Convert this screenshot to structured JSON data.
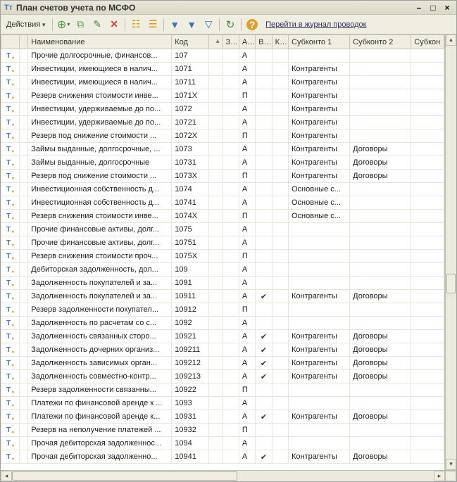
{
  "window": {
    "title": "План счетов учета по МСФО"
  },
  "toolbar": {
    "actions_label": "Действия",
    "journal_link": "Перейти в журнал проводок"
  },
  "columns": {
    "name": "Наименование",
    "code": "Код",
    "z": "З...",
    "a": "А...",
    "v": "В...",
    "k": "К...",
    "sk1": "Субконто 1",
    "sk2": "Субконто 2",
    "sk3": "Субкон"
  },
  "rows": [
    {
      "name": "Прочие долгосрочные, финансов...",
      "code": "107",
      "a": "А",
      "v": false,
      "sk1": "",
      "sk2": ""
    },
    {
      "name": "Инвестиции, имеющиеся в налич...",
      "code": "1071",
      "a": "А",
      "v": false,
      "sk1": "Контрагенты",
      "sk2": ""
    },
    {
      "name": "Инвестиции, имеющиеся в налич...",
      "code": "10711",
      "a": "А",
      "v": false,
      "sk1": "Контрагенты",
      "sk2": ""
    },
    {
      "name": "Резерв снижения стоимости инве...",
      "code": "1071Х",
      "a": "П",
      "v": false,
      "sk1": "Контрагенты",
      "sk2": ""
    },
    {
      "name": "Инвестиции, удерживаемые до по...",
      "code": "1072",
      "a": "А",
      "v": false,
      "sk1": "Контрагенты",
      "sk2": ""
    },
    {
      "name": "Инвестиции, удерживаемые до по...",
      "code": "10721",
      "a": "А",
      "v": false,
      "sk1": "Контрагенты",
      "sk2": ""
    },
    {
      "name": "Резерв под снижение стоимости ...",
      "code": "1072Х",
      "a": "П",
      "v": false,
      "sk1": "Контрагенты",
      "sk2": ""
    },
    {
      "name": "Займы выданные, долгосрочные, ...",
      "code": "1073",
      "a": "А",
      "v": false,
      "sk1": "Контрагенты",
      "sk2": "Договоры"
    },
    {
      "name": "Займы выданные, долгосрочные",
      "code": "10731",
      "a": "А",
      "v": false,
      "sk1": "Контрагенты",
      "sk2": "Договоры"
    },
    {
      "name": "Резерв под снижение стоимости ...",
      "code": "1073Х",
      "a": "П",
      "v": false,
      "sk1": "Контрагенты",
      "sk2": "Договоры"
    },
    {
      "name": "Инвестиционная собственность д...",
      "code": "1074",
      "a": "А",
      "v": false,
      "sk1": "Основные с...",
      "sk2": ""
    },
    {
      "name": "Инвестиционная собственность д...",
      "code": "10741",
      "a": "А",
      "v": false,
      "sk1": "Основные с...",
      "sk2": ""
    },
    {
      "name": "Резерв снижения стоимости инве...",
      "code": "1074Х",
      "a": "П",
      "v": false,
      "sk1": "Основные с...",
      "sk2": ""
    },
    {
      "name": "Прочие финансовые активы, долг...",
      "code": "1075",
      "a": "А",
      "v": false,
      "sk1": "",
      "sk2": ""
    },
    {
      "name": "Прочие финансовые активы, долг...",
      "code": "10751",
      "a": "А",
      "v": false,
      "sk1": "",
      "sk2": ""
    },
    {
      "name": "Резерв снижения стоимости проч...",
      "code": "1075Х",
      "a": "П",
      "v": false,
      "sk1": "",
      "sk2": ""
    },
    {
      "name": "Дебиторская задолженность, дол...",
      "code": "109",
      "a": "А",
      "v": false,
      "sk1": "",
      "sk2": ""
    },
    {
      "name": "Задолженность покупателей и за...",
      "code": "1091",
      "a": "А",
      "v": false,
      "sk1": "",
      "sk2": ""
    },
    {
      "name": "Задолженность покупателей и за...",
      "code": "10911",
      "a": "А",
      "v": true,
      "sk1": "Контрагенты",
      "sk2": "Договоры"
    },
    {
      "name": "Резерв задолженности покупател...",
      "code": "10912",
      "a": "П",
      "v": false,
      "sk1": "",
      "sk2": ""
    },
    {
      "name": "Задолженность по расчетам со с...",
      "code": "1092",
      "a": "А",
      "v": false,
      "sk1": "",
      "sk2": ""
    },
    {
      "name": "Задолженность связанных сторо...",
      "code": "10921",
      "a": "А",
      "v": true,
      "sk1": "Контрагенты",
      "sk2": "Договоры"
    },
    {
      "name": "Задолженность дочерних организ...",
      "code": "109211",
      "a": "А",
      "v": true,
      "sk1": "Контрагенты",
      "sk2": "Договоры"
    },
    {
      "name": "Задолженность зависимых орган...",
      "code": "109212",
      "a": "А",
      "v": true,
      "sk1": "Контрагенты",
      "sk2": "Договоры"
    },
    {
      "name": "Задолженность совместно-контр...",
      "code": "109213",
      "a": "А",
      "v": true,
      "sk1": "Контрагенты",
      "sk2": "Договоры"
    },
    {
      "name": "Резерв задолженности связанны...",
      "code": "10922",
      "a": "П",
      "v": false,
      "sk1": "",
      "sk2": ""
    },
    {
      "name": "Платежи по финансовой аренде к ...",
      "code": "1093",
      "a": "А",
      "v": false,
      "sk1": "",
      "sk2": ""
    },
    {
      "name": "Платежи по финансовой аренде к...",
      "code": "10931",
      "a": "А",
      "v": true,
      "sk1": "Контрагенты",
      "sk2": "Договоры"
    },
    {
      "name": "Резерв на неполучение платежей ...",
      "code": "10932",
      "a": "П",
      "v": false,
      "sk1": "",
      "sk2": ""
    },
    {
      "name": "Прочая дебиторская задолженнос...",
      "code": "1094",
      "a": "А",
      "v": false,
      "sk1": "",
      "sk2": ""
    },
    {
      "name": "Прочая дебиторская задолженно...",
      "code": "10941",
      "a": "А",
      "v": true,
      "sk1": "Контрагенты",
      "sk2": "Договоры"
    }
  ]
}
